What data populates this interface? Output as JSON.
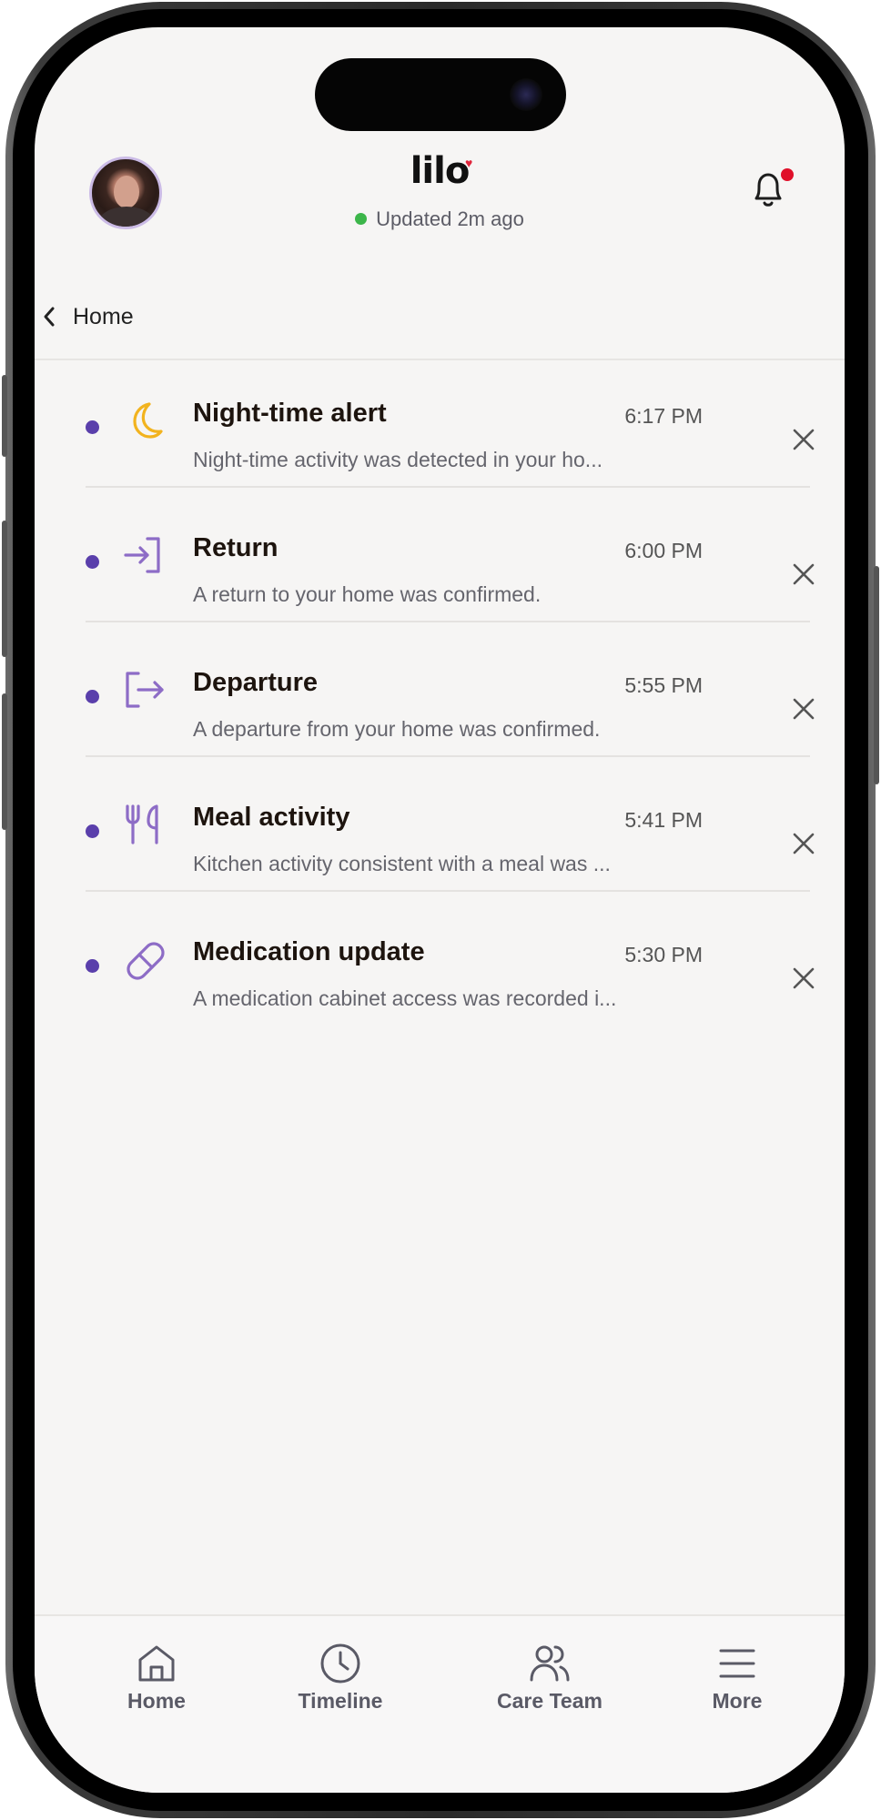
{
  "header": {
    "logo_text": "lilo",
    "status_text": "Updated 2m ago"
  },
  "breadcrumb": {
    "label": "Home"
  },
  "notifications": [
    {
      "icon": "moon-icon",
      "title": "Night-time alert",
      "time": "6:17 PM",
      "description": "Night-time activity was detected in your ho...",
      "unread": true
    },
    {
      "icon": "login-arrow-icon",
      "title": "Return",
      "time": "6:00 PM",
      "description": "A return to your home was confirmed.",
      "unread": true
    },
    {
      "icon": "logout-arrow-icon",
      "title": "Departure",
      "time": "5:55 PM",
      "description": "A departure from your home was confirmed.",
      "unread": true
    },
    {
      "icon": "utensils-icon",
      "title": "Meal activity",
      "time": "5:41 PM",
      "description": "Kitchen activity consistent with a meal was ...",
      "unread": true
    },
    {
      "icon": "pill-icon",
      "title": "Medication update",
      "time": "5:30 PM",
      "description": "A medication cabinet access was recorded i...",
      "unread": true
    }
  ],
  "tabbar": {
    "items": [
      {
        "label": "Home",
        "icon": "home-icon"
      },
      {
        "label": "Timeline",
        "icon": "clock-icon"
      },
      {
        "label": "Care Team",
        "icon": "people-icon"
      },
      {
        "label": "More",
        "icon": "menu-icon"
      }
    ]
  },
  "colors": {
    "accent": "#5a3fab",
    "icon_purple": "#8d6cc6",
    "moon_yellow": "#f2b31e",
    "badge_red": "#e0102a",
    "status_green": "#3cb64a",
    "background": "#f6f5f4"
  }
}
